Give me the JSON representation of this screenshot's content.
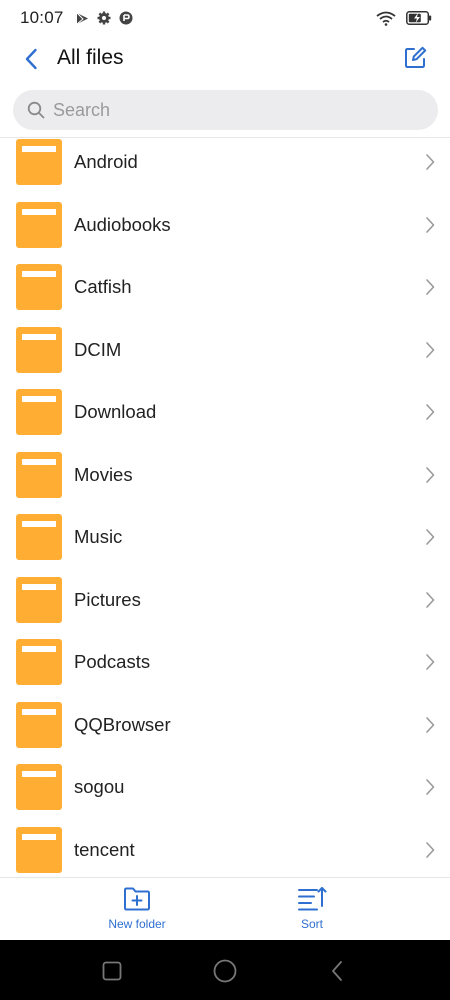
{
  "status_bar": {
    "time": "10:07",
    "left_icons": [
      "play-store-icon",
      "gear-icon",
      "vpn-icon"
    ],
    "right_icons": [
      "wifi-icon",
      "battery-charging-icon"
    ]
  },
  "header": {
    "title": "All files",
    "back_icon": "chevron-left-icon",
    "edit_icon": "edit-square-icon"
  },
  "search": {
    "placeholder": "Search",
    "value": ""
  },
  "files": [
    {
      "name": "Android"
    },
    {
      "name": "Audiobooks"
    },
    {
      "name": "Catfish"
    },
    {
      "name": "DCIM"
    },
    {
      "name": "Download"
    },
    {
      "name": "Movies"
    },
    {
      "name": "Music"
    },
    {
      "name": "Pictures"
    },
    {
      "name": "Podcasts"
    },
    {
      "name": "QQBrowser"
    },
    {
      "name": "sogou"
    },
    {
      "name": "tencent"
    }
  ],
  "bottom_actions": {
    "new_folder": {
      "label": "New folder",
      "icon": "folder-plus-icon"
    },
    "sort": {
      "label": "Sort",
      "icon": "sort-icon"
    }
  },
  "colors": {
    "accent": "#2f6fd0",
    "folder": "#ffad33",
    "folder_tab": "#ffffff"
  },
  "nav_bar": {
    "buttons": [
      "recent-apps-icon",
      "home-icon",
      "back-icon"
    ]
  }
}
